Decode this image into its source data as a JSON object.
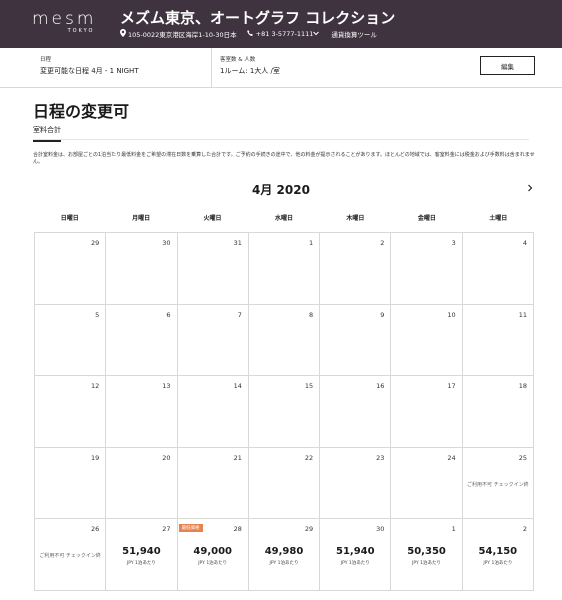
{
  "header": {
    "logo_main": "mesm",
    "logo_sub": "TOKYO",
    "title": "メズム東京、オートグラフ コレクション",
    "address": "105-0022東京港区海岸1-10-30日本",
    "phone": "+81 3-5777-1111",
    "currency_tool": "通貨換算ツール",
    "icons": [
      "map-pin-icon",
      "phone-icon",
      "chevron-down-icon"
    ]
  },
  "search": {
    "dates_label": "日程",
    "dates_value": "変更可能な日程 4月 - 1 NIGHT",
    "rooms_label": "客室数 & 人数",
    "rooms_value": "1ルーム: 1大人 /室",
    "edit_label": "編集"
  },
  "page": {
    "title": "日程の変更可",
    "tab_label": "室料合計",
    "note": "合計室料金は、お部屋ごとの1泊当たり最低料金をご希望の滞在日数を乗算した合計です。ご予約の手続きの途中で、他の料金が提示されることがあります。ほとんどの地域では、客室料金には税金および手数料は含まれません。"
  },
  "calendar": {
    "month": "4月 2020",
    "weekdays": [
      "日曜日",
      "月曜日",
      "火曜日",
      "水曜日",
      "木曜日",
      "金曜日",
      "土曜日"
    ],
    "unavailable_text": "ご利用不可 チェックイン終",
    "per_night_text": "JPY 1泊あたり",
    "lowest_badge": "最低価格",
    "days": [
      {
        "day": "29"
      },
      {
        "day": "30"
      },
      {
        "day": "31"
      },
      {
        "day": "1"
      },
      {
        "day": "2"
      },
      {
        "day": "3"
      },
      {
        "day": "4"
      },
      {
        "day": "5"
      },
      {
        "day": "6"
      },
      {
        "day": "7"
      },
      {
        "day": "8"
      },
      {
        "day": "9"
      },
      {
        "day": "10"
      },
      {
        "day": "11"
      },
      {
        "day": "12"
      },
      {
        "day": "13"
      },
      {
        "day": "14"
      },
      {
        "day": "15"
      },
      {
        "day": "16"
      },
      {
        "day": "17"
      },
      {
        "day": "18"
      },
      {
        "day": "19"
      },
      {
        "day": "20"
      },
      {
        "day": "21"
      },
      {
        "day": "22"
      },
      {
        "day": "23"
      },
      {
        "day": "24"
      },
      {
        "day": "25",
        "status": "ご利用不可 チェックイン終"
      },
      {
        "day": "26",
        "status": "ご利用不可 チェックイン終"
      },
      {
        "day": "27",
        "price": "51,940"
      },
      {
        "day": "28",
        "price": "49,000",
        "badge": "最低価格"
      },
      {
        "day": "29",
        "price": "49,980"
      },
      {
        "day": "30",
        "price": "51,940"
      },
      {
        "day": "1",
        "price": "50,350"
      },
      {
        "day": "2",
        "price": "54,150"
      }
    ]
  },
  "colors": {
    "header_bg": "#3f333f",
    "badge_bg": "#e8834f",
    "border": "#d8d8d8"
  }
}
